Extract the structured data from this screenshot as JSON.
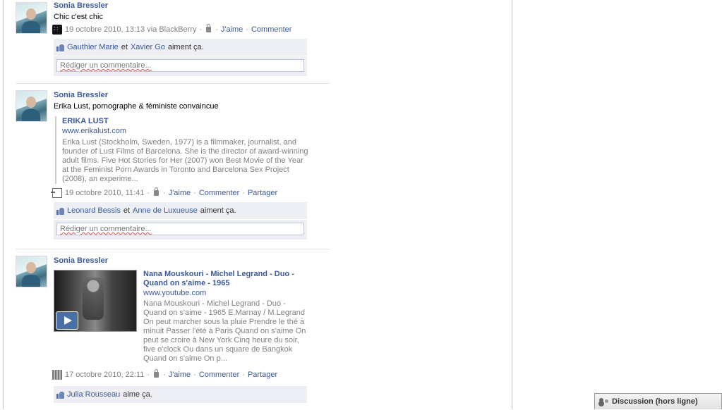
{
  "stories": [
    {
      "author": "Sonia Bressler",
      "message": "Chic c'est chic",
      "timestamp": "19 octobre 2010, 13:13 via BlackBerry",
      "source_icon": "blackberry-icon",
      "actions": {
        "like": "J'aime",
        "comment": "Commenter"
      },
      "likes": {
        "name1": "Gauthier Marie",
        "conj": "et",
        "name2": "Xavier Go",
        "suffix": "aiment ça."
      },
      "comment_placeholder": "Rédiger un commentaire..."
    },
    {
      "author": "Sonia Bressler",
      "message": "Erika Lust, pornographe & féministe convaincue",
      "attachment": {
        "title": "ERIKA LUST",
        "url": "www.erikalust.com",
        "description": "Erika Lust (Stockholm, Sweden, 1977) is a filmmaker, journalist, and founder of Lust Films of Barcelona. She is the director of award-winning adult films. Five Hot Stories for Her (2007) won Best Movie of the Year at the Feminist Porn Awards in Toronto and Barcelona Sex Project (2008), an experime..."
      },
      "timestamp": "19 octobre 2010, 11:41",
      "source_icon": "link-icon",
      "actions": {
        "like": "J'aime",
        "comment": "Commenter",
        "share": "Partager"
      },
      "likes": {
        "name1": "Leonard Bessis",
        "conj": "et",
        "name2": "Anne de Luxueuse",
        "suffix": "aiment ça."
      },
      "comment_placeholder": "Rédiger un commentaire..."
    },
    {
      "author": "Sonia Bressler",
      "video": {
        "title": "Nana Mouskouri - Michel Legrand - Duo - Quand on s'aime - 1965",
        "url": "www.youtube.com",
        "description": "Nana Mouskouri - Michel Legrand - Duo - Quand on s'aime - 1965 E.Marnay / M.Legrand On peut marcher sous la pluie Prendre le thé à minuit Passer l'été à Paris Quand on s'aime On peut se croire à New York Cinq heure du soir, five o'clock Ou dans un square de Bangkok Quand on s'aime On p..."
      },
      "timestamp": "17 octobre 2010, 22:11",
      "source_icon": "video-icon",
      "actions": {
        "like": "J'aime",
        "comment": "Commenter",
        "share": "Partager"
      },
      "likes": {
        "name1": "Julia Rousseau",
        "suffix": "aime ça."
      }
    }
  ],
  "chat": {
    "label": "Discussion (hors ligne)"
  }
}
